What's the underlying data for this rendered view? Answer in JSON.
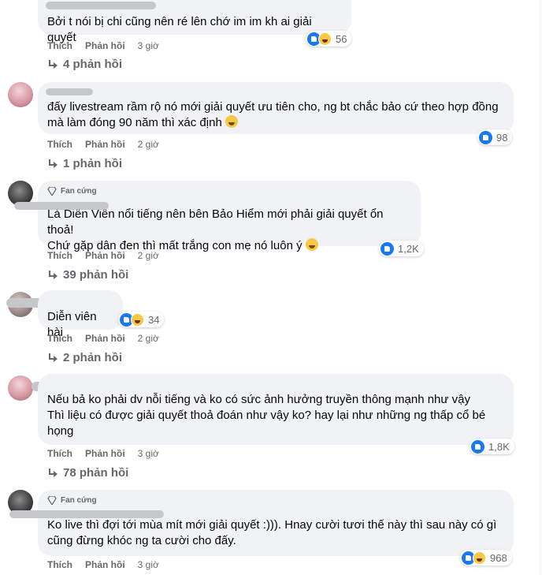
{
  "ui": {
    "like_label": "Thích",
    "reply_label": "Phản hồi",
    "fan_badge": "Fan cứng"
  },
  "comments": [
    {
      "name": "",
      "text": "Bởi t nói bị chi cũng nên ré lên chớ im im kh ai giải quyết",
      "time": "3 giờ",
      "reactions": "56",
      "replies": "4 phản hồi"
    },
    {
      "name": "",
      "text": "đấy livestream rầm rộ nó mới giải quyết ưu tiên cho, ng bt chắc bảo cứ theo hợp đồng\nmà làm đóng 90 năm thì xác định",
      "time": "2 giờ",
      "reactions": "98",
      "replies": "1 phản hồi"
    },
    {
      "name": "",
      "text": "Là Diễn Viên nổi tiếng nên bên Bảo Hiểm mới phải giải quyết ổn thoả!\nChứ gặp dân đen thì mất trắng con mẹ nó luôn ý",
      "time": "2 giờ",
      "reactions": "1,2K",
      "replies": "39 phản hồi"
    },
    {
      "name": "",
      "text": "Diễn viên hài",
      "time": "2 giờ",
      "reactions": "34",
      "replies": "2 phản hồi"
    },
    {
      "name": "",
      "text": "Nếu bả ko phải dv nỗi tiếng và ko có sức ảnh hưởng truyền thông mạnh như vậy\nThì liệu có được giải quyết thoả đoán như vậy ko? hay lại như những ng thấp cổ bé\nhọng",
      "time": "3 giờ",
      "reactions": "1,8K",
      "replies": "78 phản hồi"
    },
    {
      "name": "",
      "text": "Ko live thì đợi tới mùa mít mới giải quyết :))). Hnay cười tươi thế này thì sau này có gì\ncũng đừng khóc ng ta cười cho đấy.",
      "time": "3 giờ",
      "reactions": "968",
      "replies": ""
    }
  ],
  "colors": {
    "bubble": "#f0f2f5",
    "meta": "#65676b",
    "like": "#1877f2",
    "haha": "#f7c844"
  }
}
